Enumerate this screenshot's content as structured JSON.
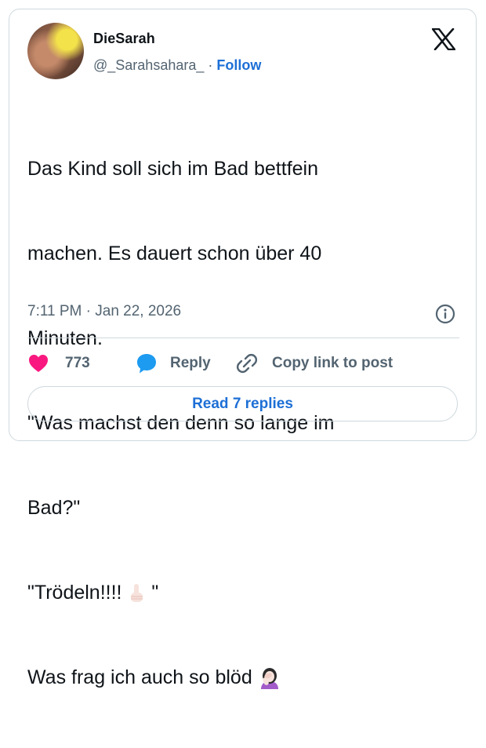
{
  "author": {
    "display_name": "DieSarah",
    "handle": "@_Sarahsahara_",
    "separator": "·",
    "follow_label": "Follow"
  },
  "tweet": {
    "line1": "Das Kind soll sich im Bad bettfein",
    "line2": "machen. Es dauert schon über 40",
    "line3": "Minuten.",
    "line4": "\"Was machst den denn so lange im",
    "line5": "Bad?\"",
    "line6a": "\"Trödeln!!!! ",
    "line6b": " \"",
    "line7": "Was frag ich auch so blöd ",
    "emoji_1": "index-pointing-up-emoji",
    "emoji_2": "woman-facepalming-emoji"
  },
  "meta": {
    "time": "7:11 PM",
    "separator": "·",
    "date": "Jan 22, 2026"
  },
  "actions": {
    "like_count": "773",
    "reply_label": "Reply",
    "copy_label": "Copy link to post"
  },
  "read_replies_label": "Read 7 replies",
  "colors": {
    "accent": "#1d6fd6",
    "like": "#f91880",
    "muted": "#536471",
    "border": "#cfd9de"
  },
  "icons": [
    "x-logo-icon",
    "info-icon",
    "heart-icon",
    "reply-bubble-icon",
    "link-icon"
  ]
}
